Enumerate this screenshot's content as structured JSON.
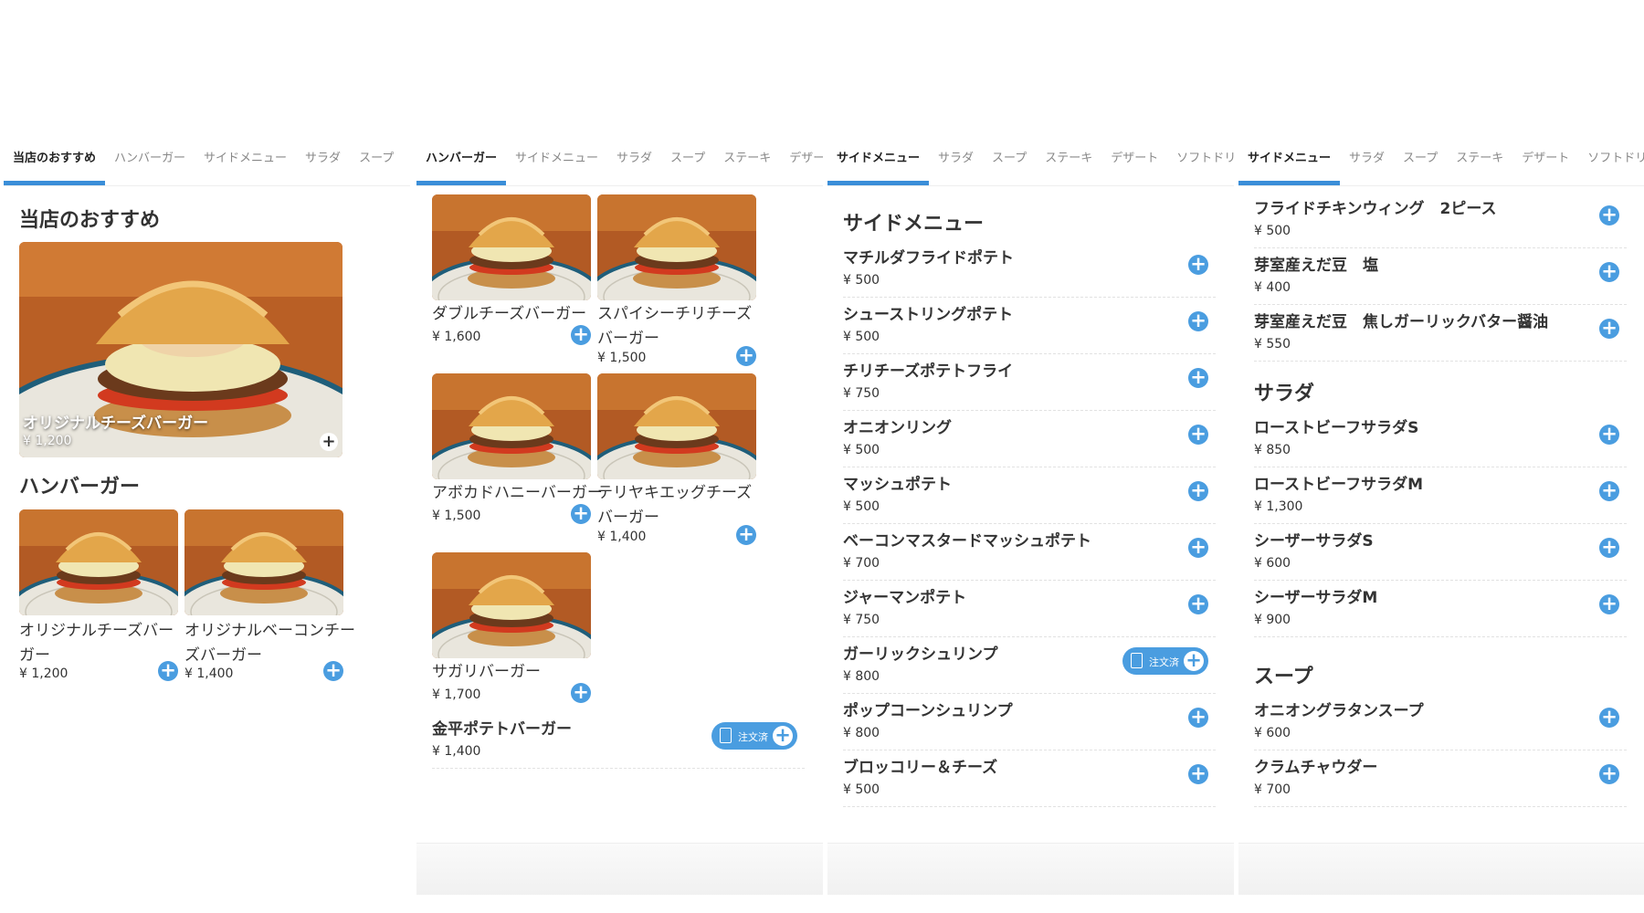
{
  "tabs": {
    "p1": [
      "当店のおすすめ",
      "ハンバーガー",
      "サイドメニュー",
      "サラダ",
      "スープ"
    ],
    "p2": [
      "ハンバーガー",
      "サイドメニュー",
      "サラダ",
      "スープ",
      "ステーキ",
      "デザー"
    ],
    "p3": [
      "サイドメニュー",
      "サラダ",
      "スープ",
      "ステーキ",
      "デザート",
      "ソフトドリ"
    ],
    "p4": [
      "サイドメニュー",
      "サラダ",
      "スープ",
      "ステーキ",
      "デザート",
      "ソフトドリ"
    ]
  },
  "panel1": {
    "section_recommend": "当店のおすすめ",
    "hero": {
      "name": "オリジナルチーズバーガー",
      "price": "¥ 1,200"
    },
    "section_burgers": "ハンバーガー",
    "items": [
      {
        "name_line1": "オリジナルチーズバー",
        "name_line2": "ガー",
        "price": "¥ 1,200"
      },
      {
        "name_line1": "オリジナルベーコンチー",
        "name_line2": "ズバーガー",
        "price": "¥ 1,400"
      }
    ]
  },
  "panel2": {
    "items": [
      {
        "name_line1": "ダブルチーズバーガー",
        "name_line2": "",
        "price": "¥ 1,600"
      },
      {
        "name_line1": "スパイシーチリチーズ",
        "name_line2": "バーガー",
        "price": "¥ 1,500"
      },
      {
        "name_line1": "アボカドハニーバーガー",
        "name_line2": "",
        "price": "¥ 1,500"
      },
      {
        "name_line1": "テリヤキエッグチーズ",
        "name_line2": "バーガー",
        "price": "¥ 1,400"
      },
      {
        "name_line1": "サガリバーガー",
        "name_line2": "",
        "price": "¥ 1,700"
      }
    ],
    "row": {
      "name": "金平ポテトバーガー",
      "price": "¥ 1,400",
      "ordered_label": "注文済"
    }
  },
  "panel3": {
    "section": "サイドメニュー",
    "rows": [
      {
        "name": "マチルダフライドポテト",
        "price": "¥ 500"
      },
      {
        "name": "シューストリングポテト",
        "price": "¥ 500"
      },
      {
        "name": "チリチーズポテトフライ",
        "price": "¥ 750"
      },
      {
        "name": "オニオンリング",
        "price": "¥ 500"
      },
      {
        "name": "マッシュポテト",
        "price": "¥ 500"
      },
      {
        "name": "ベーコンマスタードマッシュポテト",
        "price": "¥ 700"
      },
      {
        "name": "ジャーマンポテト",
        "price": "¥ 750"
      },
      {
        "name": "ガーリックシュリンプ",
        "price": "¥ 800",
        "ordered_label": "注文済"
      },
      {
        "name": "ポップコーンシュリンプ",
        "price": "¥ 800"
      },
      {
        "name": "ブロッコリー＆チーズ",
        "price": "¥ 500"
      }
    ]
  },
  "panel4": {
    "rows_top": [
      {
        "name": "フライドチキンウィング　2ピース",
        "price": "¥ 500"
      },
      {
        "name": "芽室産えだ豆　塩",
        "price": "¥ 400"
      },
      {
        "name": "芽室産えだ豆　焦しガーリックバター醤油",
        "price": "¥ 550"
      }
    ],
    "section_salad": "サラダ",
    "rows_salad": [
      {
        "name": "ローストビーフサラダS",
        "price": "¥ 850"
      },
      {
        "name": "ローストビーフサラダM",
        "price": "¥ 1,300"
      },
      {
        "name": "シーザーサラダS",
        "price": "¥ 600"
      },
      {
        "name": "シーザーサラダM",
        "price": "¥ 900"
      }
    ],
    "section_soup": "スープ",
    "rows_soup": [
      {
        "name": "オニオングラタンスープ",
        "price": "¥ 600"
      },
      {
        "name": "クラムチャウダー",
        "price": "¥ 700"
      }
    ]
  },
  "colors": {
    "accent": "#3a8ed8",
    "plus_button": "#4a9de0"
  },
  "icons": {
    "add": "plus-circle-icon",
    "ordered": "document-icon"
  }
}
